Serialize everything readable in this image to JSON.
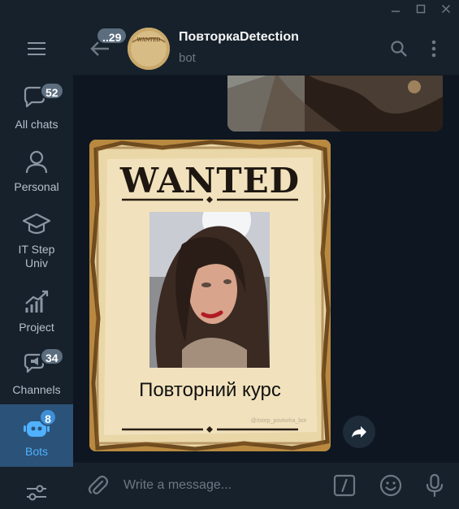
{
  "window": {
    "controls": [
      "minimize-icon",
      "maximize-icon",
      "close-icon"
    ]
  },
  "sidebar": {
    "items": [
      {
        "label": "All chats",
        "badge": "52",
        "icon": "chat-bubbles-icon"
      },
      {
        "label": "Personal",
        "badge": "",
        "icon": "person-icon"
      },
      {
        "label": "IT Step Univ",
        "badge": "",
        "icon": "graduation-cap-icon"
      },
      {
        "label": "Project",
        "badge": "",
        "icon": "chart-growth-icon"
      },
      {
        "label": "Channels",
        "badge": "34",
        "icon": "megaphone-icon"
      },
      {
        "label": "Bots",
        "badge": "8",
        "icon": "robot-icon",
        "active": true
      }
    ]
  },
  "header": {
    "back_badge": "..29",
    "title": "ПовторкаDetection",
    "status": "bot",
    "avatar_text": "WANTED"
  },
  "messages": {
    "poster": {
      "title": "WANTED",
      "caption": "Повторний курс",
      "watermark": "@itstep_povtorka_bot"
    }
  },
  "composer": {
    "placeholder": "Write a message..."
  },
  "colors": {
    "sidebar_bg": "#17212b",
    "chat_bg": "#0e1621",
    "active_folder": "#2b5278",
    "accent": "#4fb1ff",
    "badge": "#5b6d7e"
  }
}
